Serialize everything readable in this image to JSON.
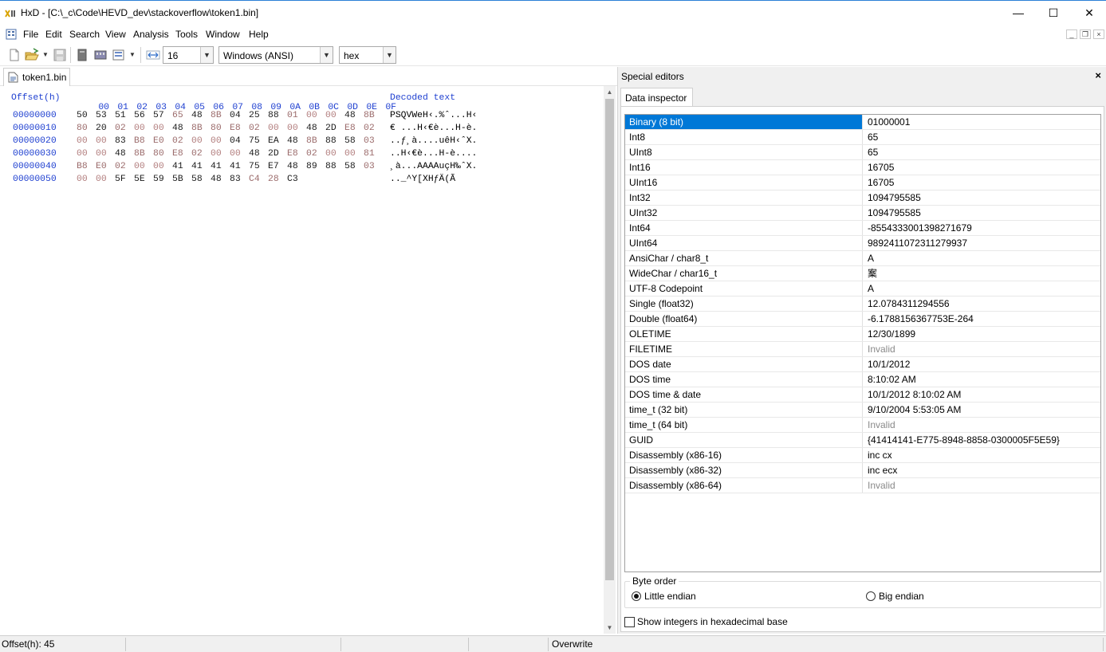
{
  "window": {
    "title": "HxD - [C:\\_c\\Code\\HEVD_dev\\stackoverflow\\token1.bin]",
    "minimize": "—",
    "maximize": "☐",
    "close": "✕"
  },
  "menu": [
    "File",
    "Edit",
    "Search",
    "View",
    "Analysis",
    "Tools",
    "Window",
    "Help"
  ],
  "toolbar": {
    "bytes_per_row": "16",
    "charset": "Windows (ANSI)",
    "offset_base": "hex"
  },
  "tab": {
    "label": "token1.bin"
  },
  "hex": {
    "offset_header": "Offset(h)",
    "columns": [
      "00",
      "01",
      "02",
      "03",
      "04",
      "05",
      "06",
      "07",
      "08",
      "09",
      "0A",
      "0B",
      "0C",
      "0D",
      "0E",
      "0F"
    ],
    "text_header": "Decoded text",
    "rows": [
      {
        "offset": "00000000",
        "bytes": [
          "50",
          "53",
          "51",
          "56",
          "57",
          "65",
          "48",
          "8B",
          "04",
          "25",
          "88",
          "01",
          "00",
          "00",
          "48",
          "8B"
        ],
        "text": "PSQVWeH‹.%ˆ...H‹"
      },
      {
        "offset": "00000010",
        "bytes": [
          "80",
          "20",
          "02",
          "00",
          "00",
          "48",
          "8B",
          "80",
          "E8",
          "02",
          "00",
          "00",
          "48",
          "2D",
          "E8",
          "02"
        ],
        "text": "€ ...H‹€è...H-è."
      },
      {
        "offset": "00000020",
        "bytes": [
          "00",
          "00",
          "83",
          "B8",
          "E0",
          "02",
          "00",
          "00",
          "04",
          "75",
          "EA",
          "48",
          "8B",
          "88",
          "58",
          "03"
        ],
        "text": "..ƒ¸à....uêH‹ˆX."
      },
      {
        "offset": "00000030",
        "bytes": [
          "00",
          "00",
          "48",
          "8B",
          "80",
          "E8",
          "02",
          "00",
          "00",
          "48",
          "2D",
          "E8",
          "02",
          "00",
          "00",
          "81"
        ],
        "text": "..H‹€è...H-è...."
      },
      {
        "offset": "00000040",
        "bytes": [
          "B8",
          "E0",
          "02",
          "00",
          "00",
          "41",
          "41",
          "41",
          "41",
          "75",
          "E7",
          "48",
          "89",
          "88",
          "58",
          "03"
        ],
        "text": "¸à...AAAAuçH‰ˆX."
      },
      {
        "offset": "00000050",
        "bytes": [
          "00",
          "00",
          "5F",
          "5E",
          "59",
          "5B",
          "58",
          "48",
          "83",
          "C4",
          "28",
          "C3"
        ],
        "text": ".._^Y[XHƒÄ(Ã"
      }
    ]
  },
  "special": {
    "title": "Special editors",
    "close": "×",
    "tab": "Data inspector",
    "rows": [
      {
        "name": "Binary (8 bit)",
        "value": "01000001"
      },
      {
        "name": "Int8",
        "value": "65"
      },
      {
        "name": "UInt8",
        "value": "65"
      },
      {
        "name": "Int16",
        "value": "16705"
      },
      {
        "name": "UInt16",
        "value": "16705"
      },
      {
        "name": "Int32",
        "value": "1094795585"
      },
      {
        "name": "UInt32",
        "value": "1094795585"
      },
      {
        "name": "Int64",
        "value": "-8554333001398271679"
      },
      {
        "name": "UInt64",
        "value": "9892411072311279937"
      },
      {
        "name": "AnsiChar / char8_t",
        "value": "A"
      },
      {
        "name": "WideChar / char16_t",
        "value": "䅁"
      },
      {
        "name": "UTF-8 Codepoint",
        "value": "A"
      },
      {
        "name": "Single (float32)",
        "value": "12.0784311294556"
      },
      {
        "name": "Double (float64)",
        "value": "-6.1788156367753E-264"
      },
      {
        "name": "OLETIME",
        "value": "12/30/1899"
      },
      {
        "name": "FILETIME",
        "value": "Invalid"
      },
      {
        "name": "DOS date",
        "value": "10/1/2012"
      },
      {
        "name": "DOS time",
        "value": "8:10:02 AM"
      },
      {
        "name": "DOS time & date",
        "value": "10/1/2012 8:10:02 AM"
      },
      {
        "name": "time_t (32 bit)",
        "value": "9/10/2004 5:53:05 AM"
      },
      {
        "name": "time_t (64 bit)",
        "value": "Invalid"
      },
      {
        "name": "GUID",
        "value": "{41414141-E775-8948-8858-0300005F5E59}"
      },
      {
        "name": "Disassembly (x86-16)",
        "value": "inc cx"
      },
      {
        "name": "Disassembly (x86-32)",
        "value": "inc ecx"
      },
      {
        "name": "Disassembly (x86-64)",
        "value": "Invalid"
      }
    ],
    "byte_order": {
      "legend": "Byte order",
      "little": "Little endian",
      "big": "Big endian",
      "selected": "little"
    },
    "hex_ints_label": "Show integers in hexadecimal base"
  },
  "status": {
    "offset": "Offset(h): 45",
    "mode": "Overwrite"
  }
}
